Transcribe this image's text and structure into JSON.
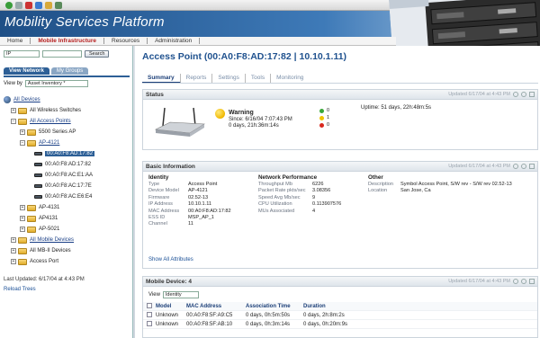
{
  "app": {
    "title": "Mobility Services Platform"
  },
  "nav": {
    "items": [
      {
        "label": "Home",
        "active": false
      },
      {
        "label": "Mobile Infrastructure",
        "active": true
      },
      {
        "label": "Resources",
        "active": false
      },
      {
        "label": "Administration",
        "active": false
      }
    ]
  },
  "left": {
    "search_select": "IP",
    "search_button": "Search",
    "tabs": [
      {
        "label": "View Network",
        "active": true
      },
      {
        "label": "My Groups",
        "active": false
      }
    ],
    "view_by_label": "View by",
    "view_by_value": "Asset Inventory *",
    "tree": {
      "all_devices": "All Devices",
      "all_wireless_switches": "All Wireless Switches",
      "all_access_points": "All Access Points",
      "ap_5500": "5500 Series AP",
      "ap_4121": "AP-4121",
      "ap4121_children": [
        "00:A0:F8:AD:17:82",
        "00:A0:F8:AD:17:82",
        "00:A0:F8:AC:E1:AA",
        "00:A0:F8:AC:17:7E",
        "00:A0:F8:AC:E6:E4"
      ],
      "ap_4131a": "AP-4131",
      "ap_4131b": "AP4131",
      "ap_5021": "AP-5021",
      "all_mobile_devices": "All Mobile Devices",
      "all_mb_devices": "All MB-II Devices",
      "access_port": "Access Port"
    },
    "last_updated": "Last Updated: 6/17/04 at 4:43 PM",
    "reload": "Reload Trees"
  },
  "main": {
    "title": "Access Point (00:A0:F8:AD:17:82 | 10.10.1.11)",
    "tabs": [
      {
        "label": "Summary",
        "active": true
      },
      {
        "label": "Reports",
        "active": false
      },
      {
        "label": "Settings",
        "active": false
      },
      {
        "label": "Tools",
        "active": false
      },
      {
        "label": "Monitoring",
        "active": false
      }
    ],
    "updated": "Updated 6/17/04 at 4:43 PM",
    "status": {
      "title": "Status",
      "state": "Warning",
      "since": "Since: 6/16/04 7:07:43 PM",
      "duration": "0 days, 21h:36m:14s",
      "counts": [
        {
          "value": "0",
          "color": "#3aa83a"
        },
        {
          "value": "1",
          "color": "#f0c400"
        },
        {
          "value": "0",
          "color": "#d9281e"
        }
      ],
      "uptime": "Uptime: 51 days, 22h:48m:5s"
    },
    "basic": {
      "title": "Basic Information",
      "identity": {
        "heading": "Identity",
        "rows": [
          {
            "k": "Type",
            "v": "Access Point"
          },
          {
            "k": "Device Model",
            "v": "AP-4121"
          },
          {
            "k": "Firmware",
            "v": "02.52-13"
          },
          {
            "k": "IP Address",
            "v": "10.10.1.11"
          },
          {
            "k": "MAC Address",
            "v": "00:A0:F8:AD:17:82"
          },
          {
            "k": "ESS ID",
            "v": "MSP_AP_1"
          },
          {
            "k": "Channel",
            "v": "11"
          }
        ]
      },
      "network": {
        "heading": "Network Performance",
        "rows": [
          {
            "k": "Throughput Mb",
            "v": "6226"
          },
          {
            "k": "Packet Rate pkts/sec",
            "v": "3.08356"
          },
          {
            "k": "Speed Avg Mb/sec",
            "v": "9"
          },
          {
            "k": "CPU Utilization",
            "v": "0.113907576"
          },
          {
            "k": "MUs Associated",
            "v": "4"
          }
        ]
      },
      "other": {
        "heading": "Other",
        "rows": [
          {
            "k": "Description",
            "v": "Symbol Access Point, S/W rev - S/W rev 02.52-13"
          },
          {
            "k": "Location",
            "v": "San Jose, Ca"
          }
        ]
      },
      "show_all": "Show All Attributes"
    },
    "mobile": {
      "title": "Mobile Device: 4",
      "view_label": "View",
      "view_value": "Identity",
      "columns": [
        "Model",
        "MAC Address",
        "Association Time",
        "Duration"
      ],
      "rows": [
        {
          "model": "Unknown",
          "mac": "00:A0:F8:5F:A9:C5",
          "assoc": "0 days, 0h:5m:50s",
          "dur": "0 days, 2h:8m:2s"
        },
        {
          "model": "Unknown",
          "mac": "00:A0:F8:5F:AB:10",
          "assoc": "0 days, 0h:3m:14s",
          "dur": "0 days, 0h:20m:9s"
        }
      ]
    }
  }
}
